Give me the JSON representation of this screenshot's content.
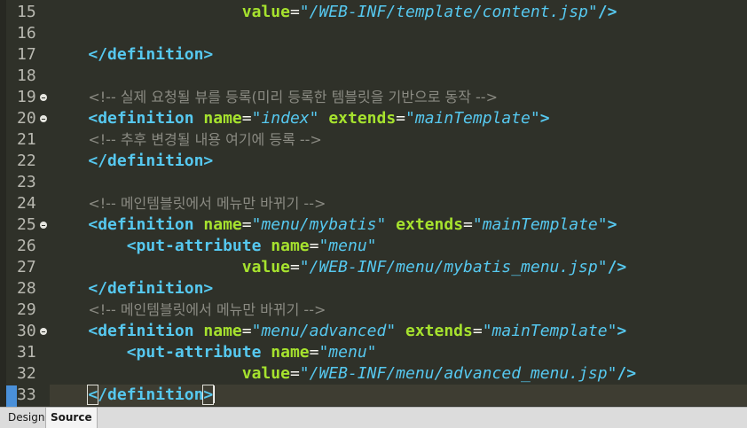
{
  "lines": [
    {
      "num": "15",
      "fold": false,
      "tokens": [
        {
          "t": "                    ",
          "c": "plain"
        },
        {
          "t": "value",
          "c": "attr"
        },
        {
          "t": "=",
          "c": "eq"
        },
        {
          "t": "\"/WEB-INF/template/content.jsp\"",
          "c": "val"
        },
        {
          "t": "/>",
          "c": "tag"
        }
      ]
    },
    {
      "num": "16",
      "fold": false,
      "tokens": []
    },
    {
      "num": "17",
      "fold": false,
      "tokens": [
        {
          "t": "    ",
          "c": "plain"
        },
        {
          "t": "</definition>",
          "c": "tag"
        }
      ]
    },
    {
      "num": "18",
      "fold": false,
      "tokens": []
    },
    {
      "num": "19",
      "fold": true,
      "tokens": [
        {
          "t": "    ",
          "c": "plain"
        },
        {
          "t": "<!-- 실제 요청될 뷰를 등록(미리 등록한 템블릿을 기반으로 동작 -->",
          "c": "cmt"
        }
      ]
    },
    {
      "num": "20",
      "fold": true,
      "tokens": [
        {
          "t": "    ",
          "c": "plain"
        },
        {
          "t": "<definition ",
          "c": "tag"
        },
        {
          "t": "name",
          "c": "attr"
        },
        {
          "t": "=",
          "c": "eq"
        },
        {
          "t": "\"index\" ",
          "c": "val"
        },
        {
          "t": "extends",
          "c": "attr"
        },
        {
          "t": "=",
          "c": "eq"
        },
        {
          "t": "\"mainTemplate\"",
          "c": "val"
        },
        {
          "t": ">",
          "c": "tag"
        }
      ]
    },
    {
      "num": "21",
      "fold": false,
      "tokens": [
        {
          "t": "    ",
          "c": "plain"
        },
        {
          "t": "<!-- 추후 변경될 내용 여기에 등록 -->",
          "c": "cmt"
        }
      ]
    },
    {
      "num": "22",
      "fold": false,
      "tokens": [
        {
          "t": "    ",
          "c": "plain"
        },
        {
          "t": "</definition>",
          "c": "tag"
        }
      ]
    },
    {
      "num": "23",
      "fold": false,
      "tokens": []
    },
    {
      "num": "24",
      "fold": false,
      "tokens": [
        {
          "t": "    ",
          "c": "plain"
        },
        {
          "t": "<!-- 메인템블릿에서 메뉴만 바뀌기 -->",
          "c": "cmt"
        }
      ]
    },
    {
      "num": "25",
      "fold": true,
      "tokens": [
        {
          "t": "    ",
          "c": "plain"
        },
        {
          "t": "<definition ",
          "c": "tag"
        },
        {
          "t": "name",
          "c": "attr"
        },
        {
          "t": "=",
          "c": "eq"
        },
        {
          "t": "\"menu/mybatis\" ",
          "c": "val"
        },
        {
          "t": "extends",
          "c": "attr"
        },
        {
          "t": "=",
          "c": "eq"
        },
        {
          "t": "\"mainTemplate\"",
          "c": "val"
        },
        {
          "t": ">",
          "c": "tag"
        }
      ]
    },
    {
      "num": "26",
      "fold": false,
      "tokens": [
        {
          "t": "        ",
          "c": "plain"
        },
        {
          "t": "<put-attribute ",
          "c": "tag"
        },
        {
          "t": "name",
          "c": "attr"
        },
        {
          "t": "=",
          "c": "eq"
        },
        {
          "t": "\"menu\"",
          "c": "val"
        }
      ]
    },
    {
      "num": "27",
      "fold": false,
      "tokens": [
        {
          "t": "                    ",
          "c": "plain"
        },
        {
          "t": "value",
          "c": "attr"
        },
        {
          "t": "=",
          "c": "eq"
        },
        {
          "t": "\"/WEB-INF/menu/mybatis_menu.jsp\"",
          "c": "val"
        },
        {
          "t": "/>",
          "c": "tag"
        }
      ]
    },
    {
      "num": "28",
      "fold": false,
      "tokens": [
        {
          "t": "    ",
          "c": "plain"
        },
        {
          "t": "</definition>",
          "c": "tag"
        }
      ]
    },
    {
      "num": "29",
      "fold": false,
      "tokens": [
        {
          "t": "    ",
          "c": "plain"
        },
        {
          "t": "<!-- 메인템블릿에서 메뉴만 바뀌기 -->",
          "c": "cmt"
        }
      ]
    },
    {
      "num": "30",
      "fold": true,
      "tokens": [
        {
          "t": "    ",
          "c": "plain"
        },
        {
          "t": "<definition ",
          "c": "tag"
        },
        {
          "t": "name",
          "c": "attr"
        },
        {
          "t": "=",
          "c": "eq"
        },
        {
          "t": "\"menu/advanced\" ",
          "c": "val"
        },
        {
          "t": "extends",
          "c": "attr"
        },
        {
          "t": "=",
          "c": "eq"
        },
        {
          "t": "\"mainTemplate\"",
          "c": "val"
        },
        {
          "t": ">",
          "c": "tag"
        }
      ]
    },
    {
      "num": "31",
      "fold": false,
      "tokens": [
        {
          "t": "        ",
          "c": "plain"
        },
        {
          "t": "<put-attribute ",
          "c": "tag"
        },
        {
          "t": "name",
          "c": "attr"
        },
        {
          "t": "=",
          "c": "eq"
        },
        {
          "t": "\"menu\"",
          "c": "val"
        }
      ]
    },
    {
      "num": "32",
      "fold": false,
      "tokens": [
        {
          "t": "                    ",
          "c": "plain"
        },
        {
          "t": "value",
          "c": "attr"
        },
        {
          "t": "=",
          "c": "eq"
        },
        {
          "t": "\"/WEB-INF/menu/advanced_menu.jsp\"",
          "c": "val"
        },
        {
          "t": "/>",
          "c": "tag"
        }
      ]
    },
    {
      "num": "33",
      "fold": false,
      "current": true,
      "tokens": [
        {
          "t": "    ",
          "c": "plain"
        },
        {
          "t": "<",
          "c": "tag",
          "box": true
        },
        {
          "t": "/definition",
          "c": "tag"
        },
        {
          "t": ">",
          "c": "tag",
          "box": true
        },
        {
          "t": "",
          "c": "caret"
        }
      ]
    }
  ],
  "tabs": {
    "design": "Design",
    "source": "Source"
  },
  "colors": {
    "background": "#2f3129",
    "tag": "#56c8ef",
    "attribute": "#a6e22e",
    "value": "#56c8ef",
    "comment": "#8a8a82"
  }
}
